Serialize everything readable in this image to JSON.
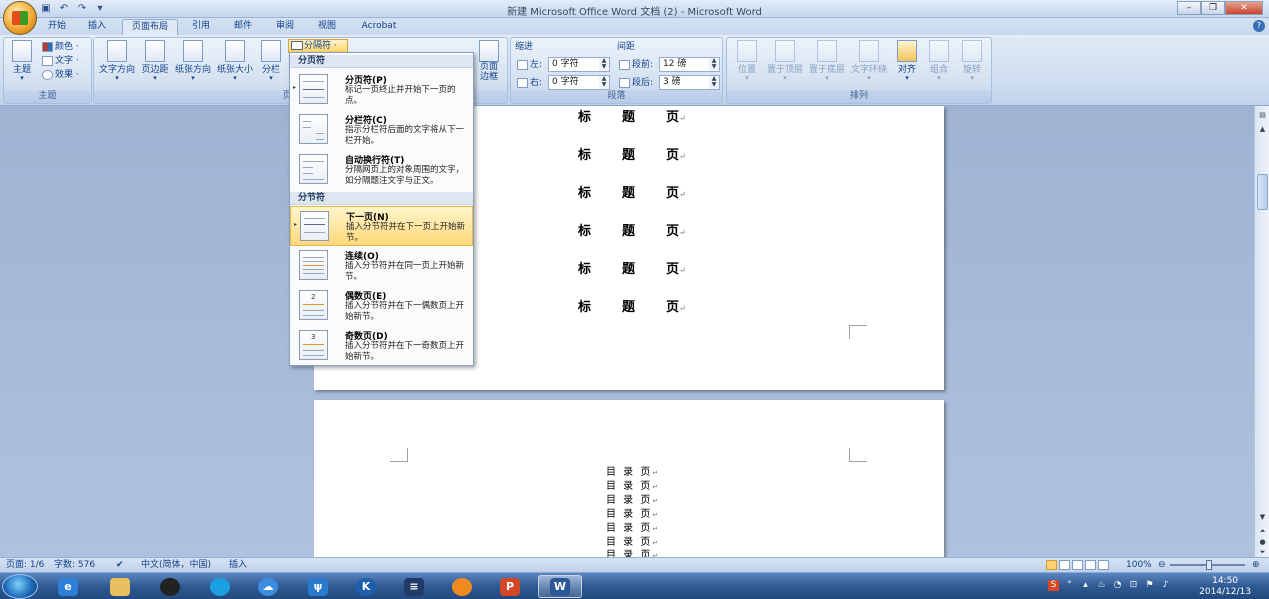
{
  "window": {
    "title": "新建 Microsoft Office Word 文档 (2) - Microsoft Word",
    "controls": [
      "–",
      "❐",
      "✕"
    ]
  },
  "tabs": [
    "开始",
    "插入",
    "页面布局",
    "引用",
    "邮件",
    "审阅",
    "视图",
    "Acrobat"
  ],
  "active_tab": "页面布局",
  "ribbon": {
    "theme_group": {
      "label": "主题",
      "theme_btn": "主题",
      "colors": "颜色 ·",
      "fonts": "文字 ·",
      "effects": "效果 ·"
    },
    "page_setup": {
      "label": "页面设置",
      "text_direction": "文字方向",
      "margins": "页边距",
      "orientation": "纸张方向",
      "size": "纸张大小",
      "columns": "分栏",
      "breaks": "分隔符 ·",
      "page_borders": "页面\n边框"
    },
    "paragraph": {
      "label": "段落",
      "indent_title": "缩进",
      "spacing_title": "间距",
      "left_label": "左:",
      "left_value": "0 字符",
      "right_label": "右:",
      "right_value": "0 字符",
      "before_label": "段前:",
      "before_value": "12 磅",
      "after_label": "段后:",
      "after_value": "3 磅"
    },
    "arrange": {
      "label": "排列",
      "position": "位置",
      "bring_front": "置于顶层",
      "send_back": "置于底层",
      "text_wrap": "文字环绕",
      "align": "对齐",
      "group": "组合",
      "rotate": "旋转"
    }
  },
  "breaks_menu": {
    "page_breaks_header": "分页符",
    "section_breaks_header": "分节符",
    "items": [
      {
        "title": "分页符(P)",
        "desc": "标记一页终止并开始下一页的点。"
      },
      {
        "title": "分栏符(C)",
        "desc": "指示分栏符后面的文字将从下一栏开始。"
      },
      {
        "title": "自动换行符(T)",
        "desc": "分隔网页上的对象周围的文字，如分隔题注文字与正文。"
      },
      {
        "title": "下一页(N)",
        "desc": "插入分节符并在下一页上开始新节。"
      },
      {
        "title": "连续(O)",
        "desc": "插入分节符并在同一页上开始新节。"
      },
      {
        "title": "偶数页(E)",
        "desc": "插入分节符并在下一偶数页上开始新节。"
      },
      {
        "title": "奇数页(D)",
        "desc": "插入分节符并在下一奇数页上开始新节。"
      }
    ],
    "highlighted_index": 3,
    "icon_labels": {
      "even": "2",
      "odd": "3"
    }
  },
  "document": {
    "page1_lines": [
      "标",
      "题",
      "页",
      "标",
      "题",
      "页",
      "标",
      "题",
      "页",
      "标",
      "题",
      "页",
      "标",
      "题",
      "页",
      "标",
      "题",
      "页"
    ],
    "paragraph_mark": "↵",
    "page2_line": "目 录 页",
    "page2_line_count_text": [
      "目 录 页",
      "目 录 页",
      "目 录 页",
      "目 录 页",
      "目 录 页",
      "目 录 页",
      "目 录 页"
    ]
  },
  "statusbar": {
    "page": "页面: 1/6",
    "words": "字数: 576",
    "language": "中文(简体，中国)",
    "mode": "插入",
    "zoom": "100%"
  },
  "taskbar": {
    "apps": [
      "ie-icon",
      "explorer-icon",
      "qq-icon",
      "browser-icon",
      "baidu-cloud-icon",
      "app-icon",
      "k-icon",
      "media-icon",
      "orange-icon",
      "ppt-icon",
      "word-icon"
    ],
    "time": "14:50",
    "date": "2014/12/13"
  }
}
